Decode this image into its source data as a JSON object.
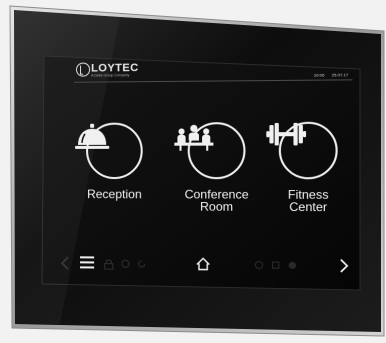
{
  "logo": {
    "text": "LOYTEC",
    "subtitle": "A Delta Group Company"
  },
  "status": {
    "time": "10:06",
    "date": "25.07.17"
  },
  "tiles": [
    {
      "label": "Reception",
      "icon": "service-bell-icon"
    },
    {
      "label": "Conference\nRoom",
      "icon": "meeting-people-icon"
    },
    {
      "label": "Fitness\nCenter",
      "icon": "dumbbell-icon"
    }
  ],
  "nav": {
    "back": "back-arrow-icon",
    "menu": "menu-icon",
    "home": "home-icon",
    "next": "next-arrow-icon"
  },
  "colors": {
    "screen": "#0c0c0c",
    "bezel": "#121212",
    "frame": "#c8c8c8",
    "text": "#f2f2f2"
  }
}
